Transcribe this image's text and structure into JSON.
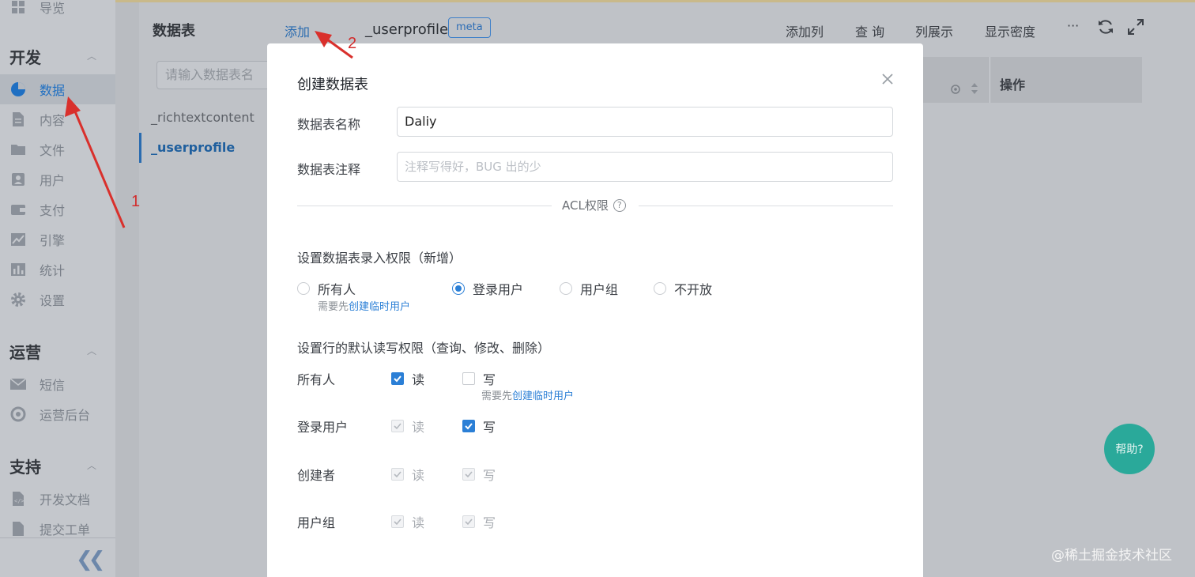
{
  "sidebar": {
    "top_item": "导览",
    "sections": [
      {
        "title": "开发",
        "items": [
          {
            "label": "数据",
            "icon": "pie-chart-icon",
            "active": true
          },
          {
            "label": "内容",
            "icon": "document-icon"
          },
          {
            "label": "文件",
            "icon": "folder-icon"
          },
          {
            "label": "用户",
            "icon": "user-card-icon"
          },
          {
            "label": "支付",
            "icon": "wallet-icon"
          },
          {
            "label": "引擎",
            "icon": "trend-icon"
          },
          {
            "label": "统计",
            "icon": "bar-chart-icon"
          },
          {
            "label": "设置",
            "icon": "gear-icon"
          }
        ]
      },
      {
        "title": "运营",
        "items": [
          {
            "label": "短信",
            "icon": "mail-icon"
          },
          {
            "label": "运营后台",
            "icon": "dashboard-icon"
          }
        ]
      },
      {
        "title": "支持",
        "items": [
          {
            "label": "开发文档",
            "icon": "code-doc-icon"
          },
          {
            "label": "提交工单",
            "icon": "ticket-icon"
          }
        ]
      }
    ]
  },
  "tables_panel": {
    "title": "数据表",
    "add_label": "添加",
    "search_placeholder": "请输入数据表名",
    "tables": [
      "_richtextcontent",
      "_userprofile"
    ],
    "active_table": "_userprofile"
  },
  "main": {
    "title": "_userprofile",
    "badge": "meta",
    "toolbar": {
      "add_column": "添加列",
      "query": "查 询",
      "columns": "列展示",
      "density": "显示密度",
      "more": "···"
    },
    "grid": {
      "actions_header": "操作"
    },
    "help_label": "帮助?"
  },
  "watermark": "@稀土掘金技术社区",
  "annotations": [
    "1",
    "2"
  ],
  "modal": {
    "title": "创建数据表",
    "name_label": "数据表名称",
    "name_value": "Daliy",
    "comment_label": "数据表注释",
    "comment_placeholder": "注释写得好，BUG 出的少",
    "acl_label": "ACL权限",
    "insert_section": "设置数据表录入权限（新增）",
    "insert_options": [
      {
        "label": "所有人",
        "selected": false
      },
      {
        "label": "登录用户",
        "selected": true
      },
      {
        "label": "用户组",
        "selected": false
      },
      {
        "label": "不开放",
        "selected": false
      }
    ],
    "hint_prefix": "需要先",
    "hint_link": "创建临时用户",
    "row_section": "设置行的默认读写权限（查询、修改、删除）",
    "read_label": "读",
    "write_label": "写",
    "rows": [
      {
        "role": "所有人",
        "read": "checked",
        "write": "unchecked"
      },
      {
        "role": "登录用户",
        "read": "checked-disabled",
        "write": "checked"
      },
      {
        "role": "创建者",
        "read": "checked-disabled",
        "write": "checked-disabled"
      },
      {
        "role": "用户组",
        "read": "checked-disabled",
        "write": "checked-disabled"
      }
    ],
    "accent": "#2b7fd6"
  }
}
